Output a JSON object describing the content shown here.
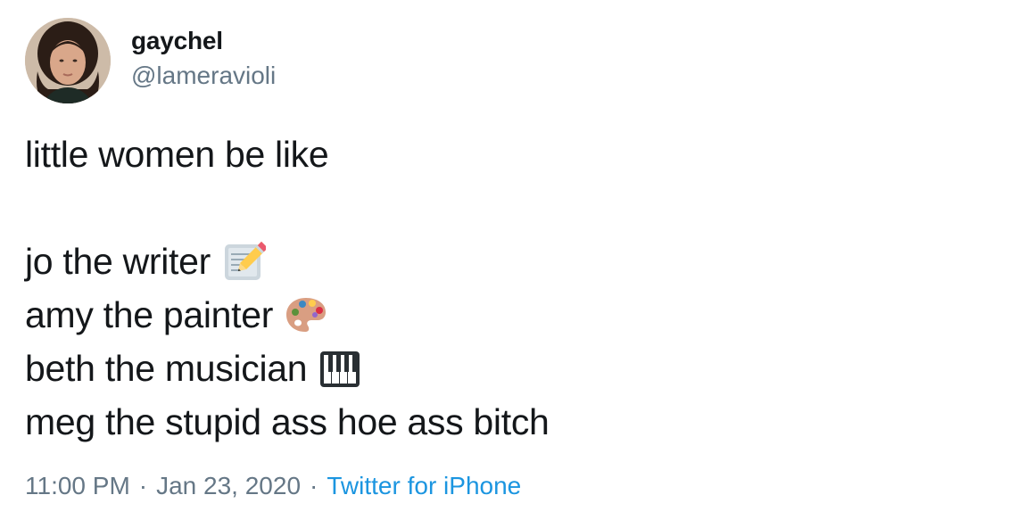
{
  "user": {
    "display_name": "gaychel",
    "handle": "@lameravioli"
  },
  "tweet": {
    "lines": [
      {
        "text": "little women be like",
        "emoji": ""
      },
      {
        "text": "",
        "emoji": ""
      },
      {
        "text": "jo the writer",
        "emoji": "memo-icon"
      },
      {
        "text": "amy the painter",
        "emoji": "artist-palette-icon"
      },
      {
        "text": "beth the musician",
        "emoji": "musical-keyboard-icon"
      },
      {
        "text": "meg the stupid ass hoe ass bitch",
        "emoji": ""
      }
    ],
    "time": "11:00 PM",
    "separator": "·",
    "date": "Jan 23, 2020",
    "source": "Twitter for iPhone"
  },
  "colors": {
    "text": "#14171a",
    "secondary": "#657786",
    "link": "#1b95e0"
  }
}
